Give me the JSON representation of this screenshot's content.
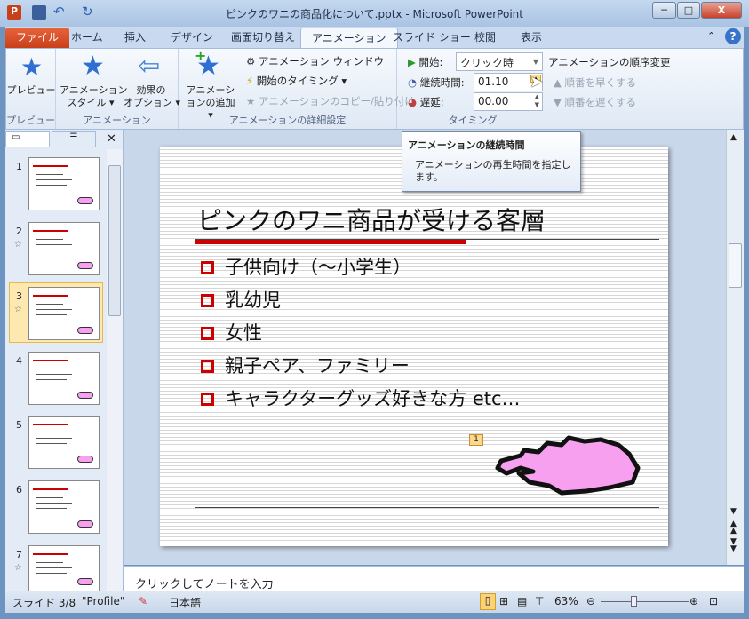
{
  "window": {
    "title": "ピンクのワニの商品化について.pptx - Microsoft PowerPoint",
    "minimize": "─",
    "maximize": "□",
    "close": "X"
  },
  "tabs": [
    "ファイル",
    "ホーム",
    "挿入",
    "デザイン",
    "画面切り替え",
    "アニメーション",
    "スライド ショー",
    "校閲",
    "表示"
  ],
  "active_tab": "アニメーション",
  "ribbon": {
    "preview": {
      "button": "プレビュー",
      "group": "プレビュー"
    },
    "animation": {
      "style": "アニメーション\nスタイル ▾",
      "options": "効果の\nオプション ▾",
      "group": "アニメーション"
    },
    "advanced": {
      "add": "アニメーションの追加 ▾",
      "pane": "アニメーション ウィンドウ",
      "trigger": "開始のタイミング ▾",
      "painter": "アニメーションのコピー/貼り付け",
      "group": "アニメーションの詳細設定"
    },
    "timing": {
      "start_label": "開始:",
      "start_value": "クリック時",
      "duration_label": "継続時間:",
      "duration_value": "01.10",
      "delay_label": "遅延:",
      "delay_value": "00.00",
      "group": "タイミング"
    },
    "reorder": {
      "title": "アニメーションの順序変更",
      "earlier": "順番を早くする",
      "later": "順番を遅くする"
    }
  },
  "tooltip": {
    "title": "アニメーションの継続時間",
    "body": "アニメーションの再生時間を指定します。"
  },
  "slides": {
    "numbers": [
      "1",
      "2",
      "3",
      "4",
      "5",
      "6",
      "7"
    ],
    "current": 3
  },
  "slide": {
    "title": "ピンクのワニ商品が受ける客層",
    "bullets": [
      "子供向け（～小学生）",
      "乳幼児",
      "女性",
      "親子ペア、ファミリー",
      "キャラクターグッズ好きな方 etc…"
    ],
    "animation_tag": "1"
  },
  "notes": {
    "placeholder": "クリックしてノートを入力"
  },
  "status": {
    "slide": "スライド 3/8",
    "theme": "\"Profile\"",
    "language": "日本語",
    "zoom": "63%",
    "zoom_percent": 63
  },
  "colors": {
    "accent": "#cc0000",
    "file_tab": "#d4522a",
    "croc": "#f7a0f0"
  }
}
